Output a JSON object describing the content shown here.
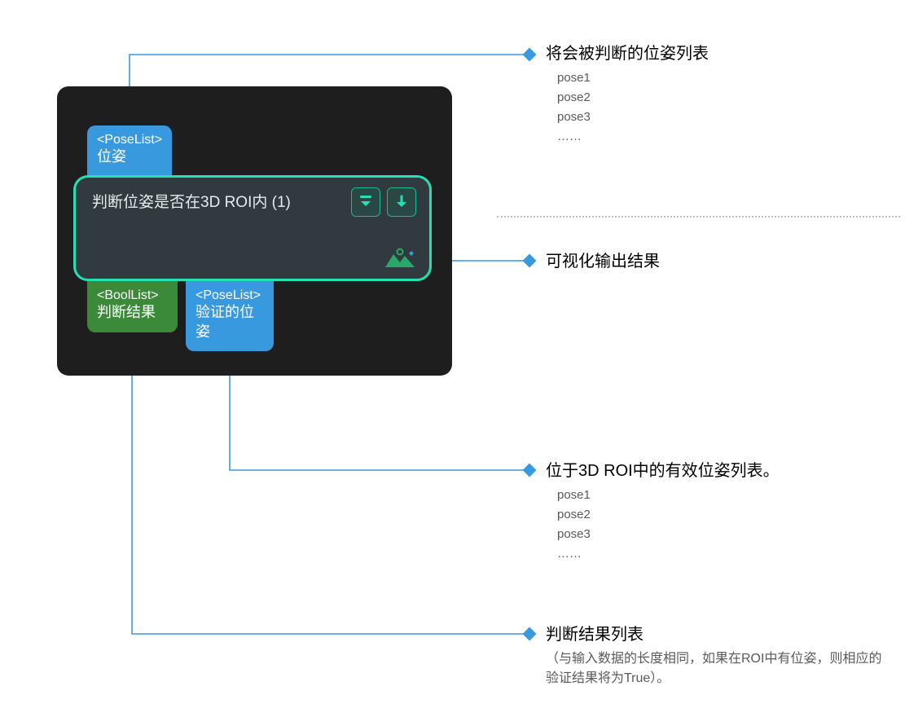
{
  "panel": {},
  "node": {
    "title": "判断位姿是否在3D ROI内 (1)"
  },
  "ports": {
    "input_poselist": {
      "type": "<PoseList>",
      "name": "位姿"
    },
    "output_boollist": {
      "type": "<BoolList>",
      "name": "判断结果"
    },
    "output_poselist": {
      "type": "<PoseList>",
      "name": "验证的位姿"
    }
  },
  "callouts": {
    "input_desc": {
      "title": "将会被判断的位姿列表",
      "items": [
        "pose1",
        "pose2",
        "pose3",
        "……"
      ]
    },
    "visualize": {
      "title": "可视化输出结果"
    },
    "valid_poses": {
      "title": "位于3D ROI中的有效位姿列表。",
      "items": [
        "pose1",
        "pose2",
        "pose3",
        "……"
      ]
    },
    "result_list": {
      "title": "判断结果列表",
      "note": "（与输入数据的长度相同，如果在ROI中有位姿，则相应的验证结果将为True）。"
    }
  },
  "colors": {
    "accent_blue": "#3999de",
    "accent_green": "#3a8a3a",
    "teal": "#24e0b4",
    "panel_bg": "#1f1e1e"
  }
}
